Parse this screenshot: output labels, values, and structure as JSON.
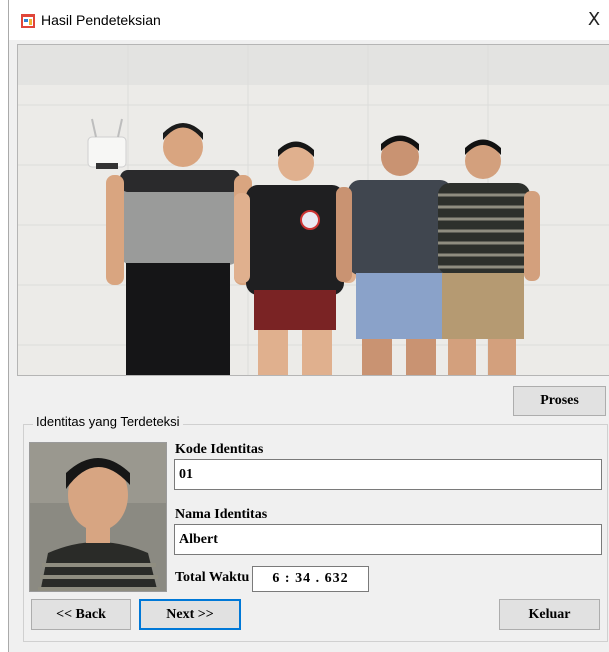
{
  "window": {
    "title": "Hasil Pendeteksian",
    "close_glyph": "X",
    "app_icon": "app-form-icon"
  },
  "main_image": {
    "icon": "group-photo"
  },
  "buttons": {
    "proses": "Proses",
    "back": "<< Back",
    "next": "Next >>",
    "keluar": "Keluar"
  },
  "group": {
    "title": "Identitas yang Terdeteksi",
    "kode_label": "Kode Identitas",
    "kode_value": "01",
    "nama_label": "Nama Identitas",
    "nama_value": "Albert",
    "waktu_label": "Total Waktu",
    "waktu_value": "6 : 34 . 632"
  },
  "colors": {
    "accent": "#0078d7",
    "window_bg": "#f0f0f0"
  }
}
